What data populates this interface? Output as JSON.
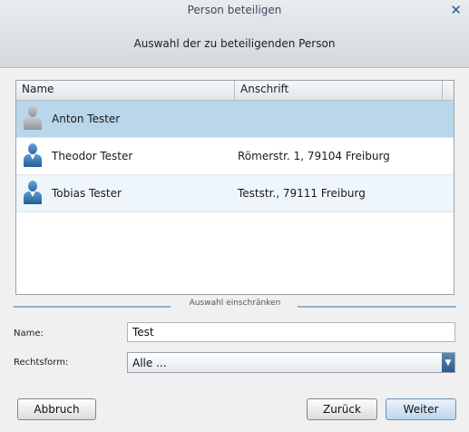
{
  "window": {
    "title": "Person beteiligen",
    "close_icon": "close-icon"
  },
  "header": {
    "subtitle": "Auswahl der zu beteiligenden Person"
  },
  "grid": {
    "columns": {
      "name": "Name",
      "address": "Anschrift"
    },
    "rows": [
      {
        "name": "Anton Tester",
        "address": "",
        "icon": "person-icon-grey",
        "selected": true
      },
      {
        "name": "Theodor Tester",
        "address": "Römerstr. 1, 79104 Freiburg",
        "icon": "person-icon-blue"
      },
      {
        "name": "Tobias Tester",
        "address": "Teststr., 79111 Freiburg",
        "icon": "person-icon-blue"
      }
    ]
  },
  "filter": {
    "legend": "Auswahl einschränken",
    "name_label": "Name:",
    "name_value": "Test",
    "legal_form_label": "Rechtsform:",
    "legal_form_value": "Alle ..."
  },
  "buttons": {
    "cancel": "Abbruch",
    "back": "Zurück",
    "next": "Weiter"
  }
}
